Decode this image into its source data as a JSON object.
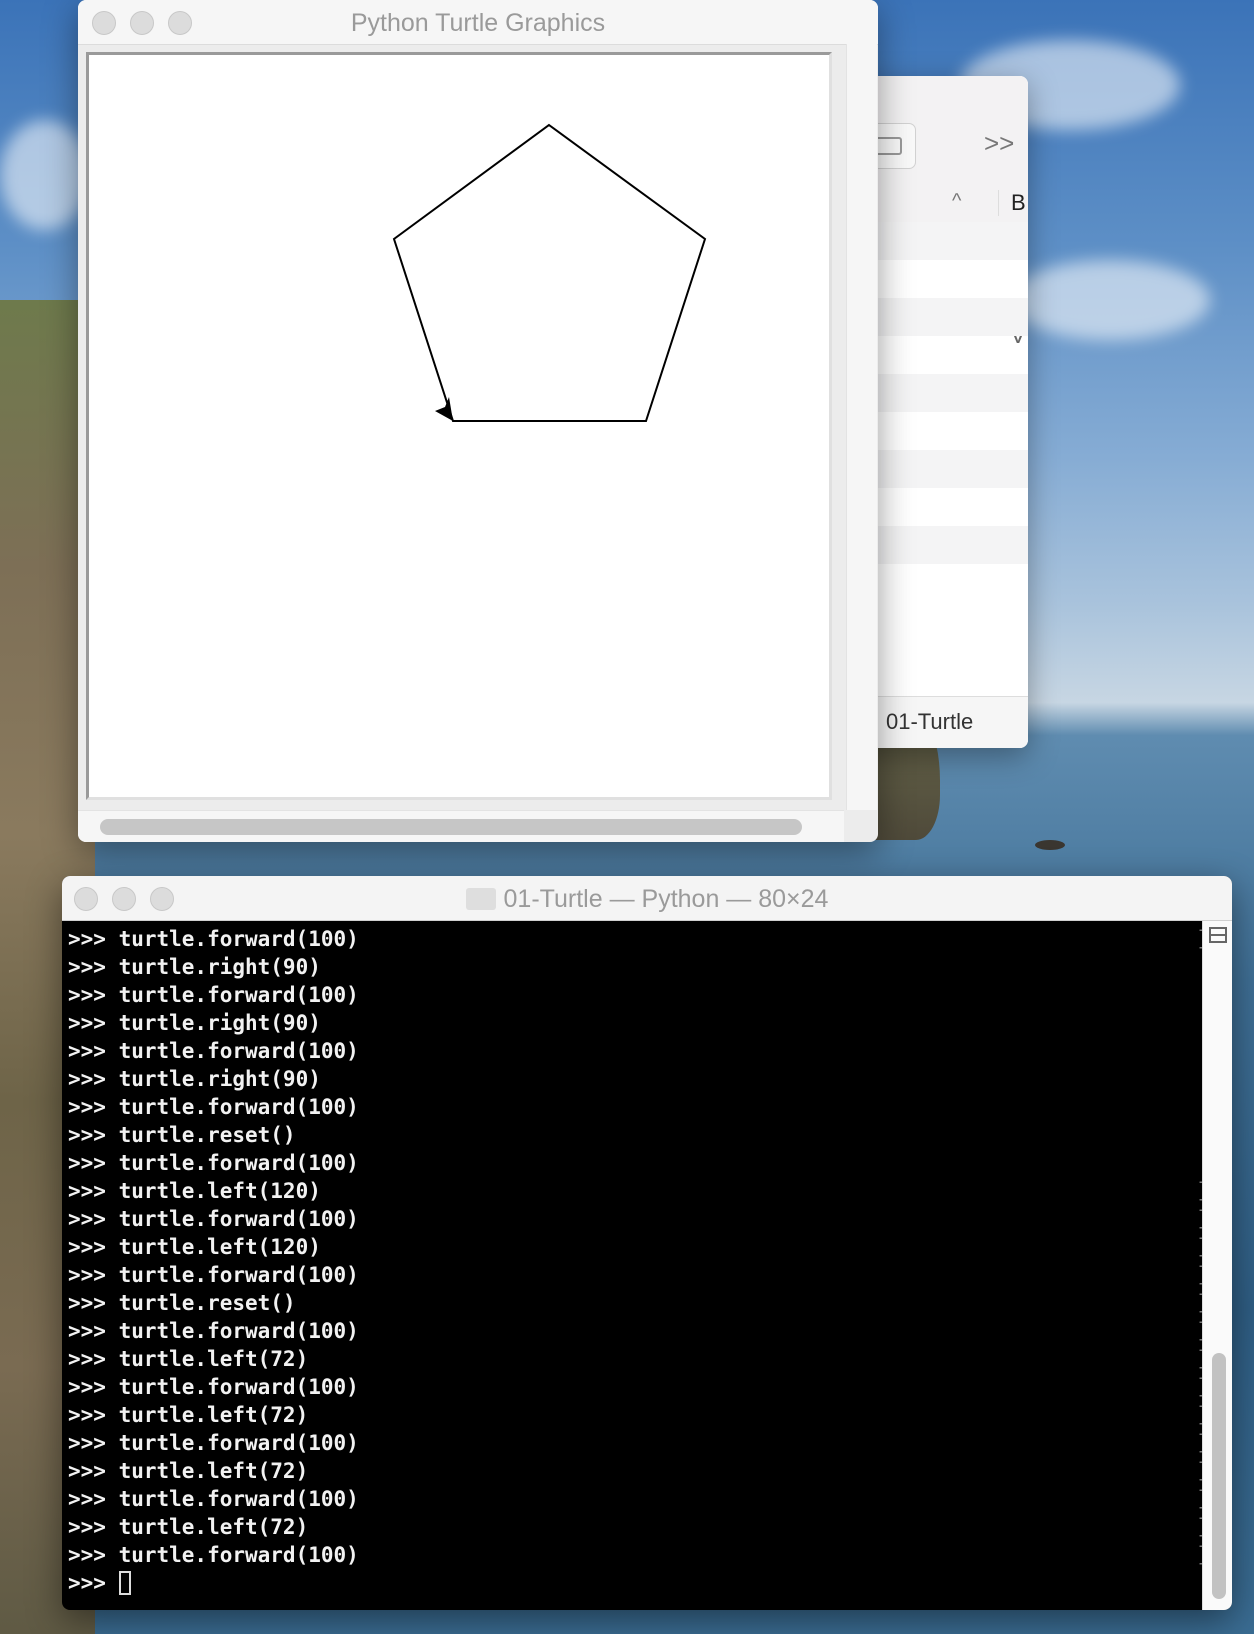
{
  "finder": {
    "sort_column_label": "B",
    "partial_header": "V",
    "path_folder_label": "01-Turtle"
  },
  "turtle_window": {
    "title": "Python Turtle Graphics"
  },
  "terminal": {
    "title": "01-Turtle — Python — 80×24",
    "lines": [
      ">>> turtle.forward(100)",
      ">>> turtle.right(90)",
      ">>> turtle.forward(100)",
      ">>> turtle.right(90)",
      ">>> turtle.forward(100)",
      ">>> turtle.right(90)",
      ">>> turtle.forward(100)",
      ">>> turtle.reset()",
      ">>> turtle.forward(100)",
      ">>> turtle.left(120)",
      ">>> turtle.forward(100)",
      ">>> turtle.left(120)",
      ">>> turtle.forward(100)",
      ">>> turtle.reset()",
      ">>> turtle.forward(100)",
      ">>> turtle.left(72)",
      ">>> turtle.forward(100)",
      ">>> turtle.left(72)",
      ">>> turtle.forward(100)",
      ">>> turtle.left(72)",
      ">>> turtle.forward(100)",
      ">>> turtle.left(72)",
      ">>> turtle.forward(100)"
    ],
    "prompt": ">>> "
  },
  "icons": {
    "finder_tag": "tag-icon",
    "finder_more": "double-chevron-icon",
    "finder_sort": "chevron-up-icon",
    "terminal_folder": "folder-icon",
    "terminal_split": "split-pane-icon",
    "turtle_cursor": "arrow-cursor-icon"
  },
  "colors": {
    "terminal_bg": "#000000",
    "terminal_fg": "#f2f2f2",
    "canvas_bg": "#ffffff",
    "folder_blue": "#6bb0e8"
  }
}
